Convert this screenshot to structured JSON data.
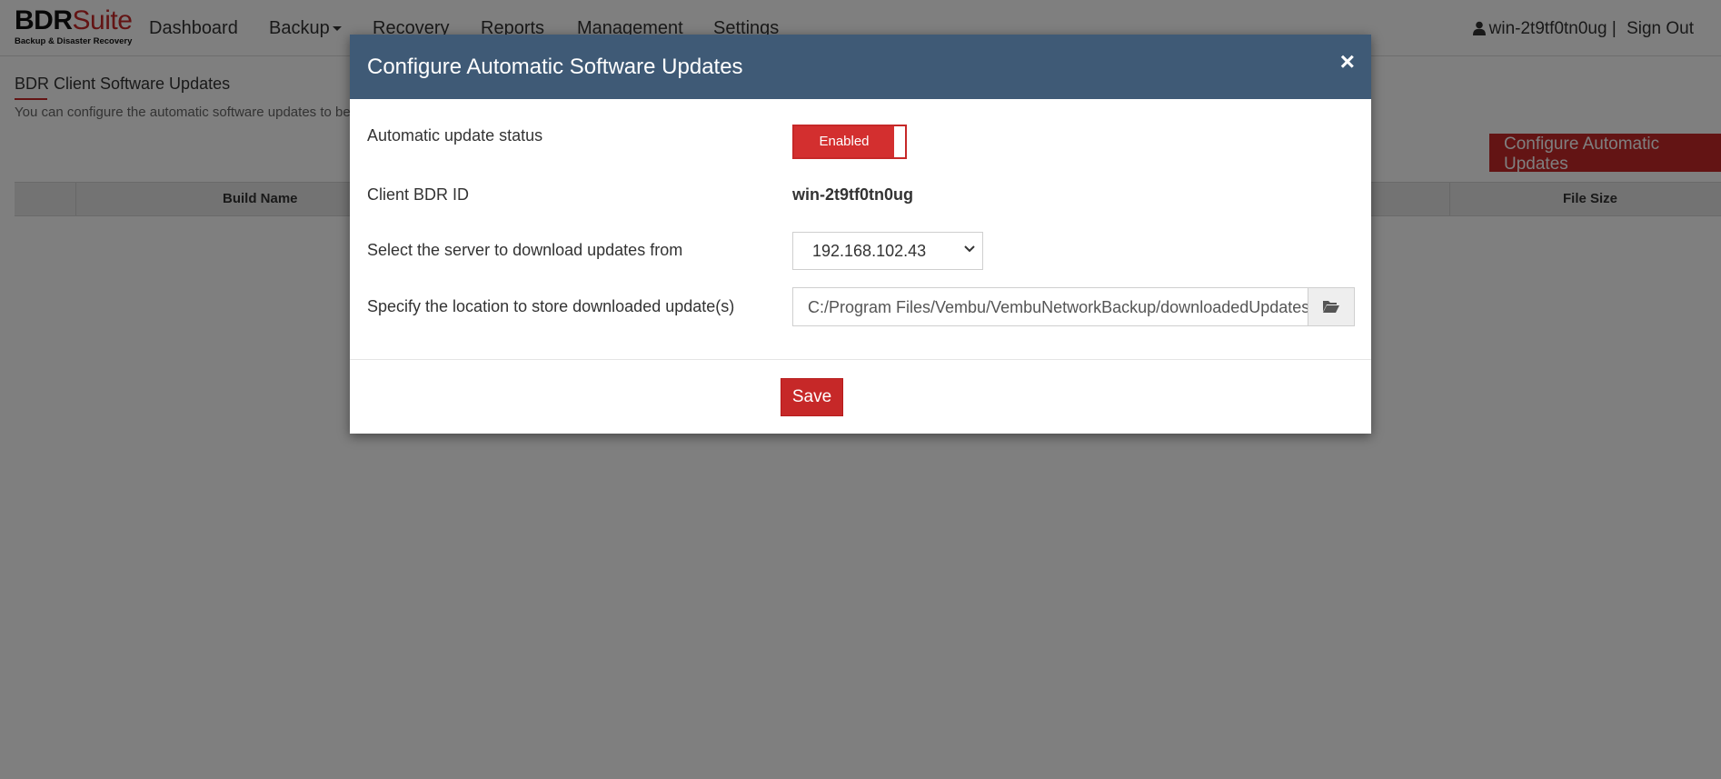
{
  "brand": {
    "name_part1": "BDR",
    "name_part2": "Suite",
    "tagline": "Backup & Disaster Recovery"
  },
  "nav": {
    "items": [
      {
        "label": "Dashboard"
      },
      {
        "label": "Backup"
      },
      {
        "label": "Recovery"
      },
      {
        "label": "Reports"
      },
      {
        "label": "Management"
      },
      {
        "label": "Settings"
      }
    ],
    "user": "win-2t9tf0tn0ug |",
    "signout": "Sign Out"
  },
  "page": {
    "title": "BDR Client Software Updates",
    "description": "You can configure the automatic software updates to be c",
    "configure_button": "Configure Automatic Updates",
    "table_headers": [
      "Build Name",
      "File Size"
    ]
  },
  "modal": {
    "title": "Configure Automatic Software Updates",
    "close": "×",
    "fields": {
      "status_label": "Automatic update status",
      "status_value": "Enabled",
      "client_id_label": "Client BDR ID",
      "client_id_value": "win-2t9tf0tn0ug",
      "server_label": "Select the server to download updates from",
      "server_value": "192.168.102.43",
      "location_label": "Specify the location to store downloaded update(s)",
      "location_value": "C:/Program Files/Vembu/VembuNetworkBackup/downloadedUpdates"
    },
    "save_label": "Save"
  },
  "colors": {
    "accent": "#c62828",
    "modal_header": "#3f5a76"
  },
  "icons": {
    "user": "user-icon",
    "folder": "folder-open-icon",
    "chevron": "chevron-down-icon",
    "close": "close-icon"
  }
}
